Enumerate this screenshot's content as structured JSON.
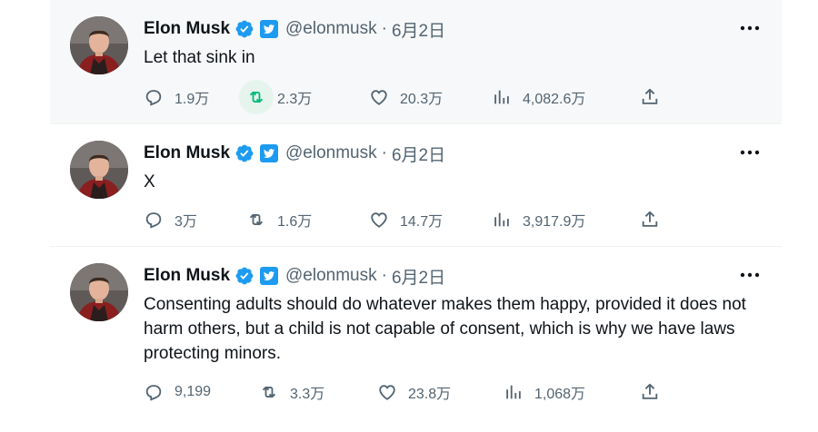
{
  "tweets": [
    {
      "name": "Elon Musk",
      "handle": "@elonmusk",
      "separator": "·",
      "date": "6月2日",
      "text": "Let that sink in",
      "replies": "1.9万",
      "retweets": "2.3万",
      "likes": "20.3万",
      "views": "4,082.6万"
    },
    {
      "name": "Elon Musk",
      "handle": "@elonmusk",
      "separator": "·",
      "date": "6月2日",
      "text": "X",
      "replies": "3万",
      "retweets": "1.6万",
      "likes": "14.7万",
      "views": "3,917.9万"
    },
    {
      "name": "Elon Musk",
      "handle": "@elonmusk",
      "separator": "·",
      "date": "6月2日",
      "text": "Consenting adults should do whatever makes them happy, provided it does not harm others, but a child is not capable of consent, which is why we have laws protecting minors.",
      "replies": "9,199",
      "retweets": "3.3万",
      "likes": "23.8万",
      "views": "1,068万"
    }
  ],
  "icons": {
    "verified": "verified-badge-icon",
    "twitter_badge": "twitter-bird-badge-icon",
    "more": "more-icon",
    "reply": "reply-icon",
    "retweet": "retweet-icon",
    "like": "like-icon",
    "views": "views-icon",
    "share": "share-icon"
  },
  "colors": {
    "verified_blue": "#1d9bf0",
    "text_primary": "#0f1419",
    "text_secondary": "#536471",
    "retweet_highlight_bg": "#e6f4ee",
    "retweet_highlight": "#00ba7c"
  }
}
